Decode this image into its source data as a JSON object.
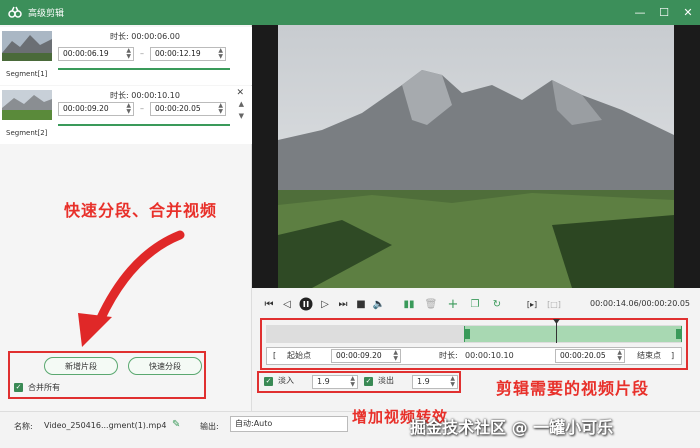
{
  "window": {
    "title": "高级剪辑",
    "minimize_icon": "minimize-icon",
    "maximize_icon": "maximize-icon",
    "close_icon": "close-icon"
  },
  "segments": [
    {
      "label": "Segment[1]",
      "duration_label": "时长:",
      "duration": "00:00:06.00",
      "start": "00:00:06.19",
      "end": "00:00:12.19",
      "separator": "–"
    },
    {
      "label": "Segment[2]",
      "duration_label": "时长:",
      "duration": "00:00:10.10",
      "start": "00:00:09.20",
      "end": "00:00:20.05",
      "separator": "–"
    }
  ],
  "left_panel": {
    "annotation": "快速分段、合并视频",
    "add_segment_button": "新增片段",
    "quick_split_button": "快速分段",
    "merge_all_label": "合并所有",
    "merge_all_checked": true
  },
  "player": {
    "timecode": "00:00:14.06/00:00:20.05",
    "range": {
      "start_label": "起始点",
      "start": "00:00:09.20",
      "duration_label": "时长:",
      "duration": "00:00:10.10",
      "end": "00:00:20.05",
      "end_label": "结束点",
      "bracket_open": "[",
      "bracket_close": "]"
    },
    "timeline_selection": {
      "start": 0.475,
      "end": 1.0,
      "playhead": 0.697
    },
    "fade_in_label": "淡入",
    "fade_in_value": "1.9",
    "fade_in_checked": true,
    "fade_out_label": "淡出",
    "fade_out_value": "1.9",
    "fade_out_checked": true,
    "annotation_segment": "剪辑需要的视频片段",
    "annotation_transition": "增加视频转效",
    "watermark": "掘金技术社区 @ 一罐小可乐"
  },
  "bottom": {
    "name_label": "名称:",
    "name_value": "Video_250416...gment(1).mp4",
    "output_label": "输出:",
    "output_value": "自动:Auto"
  },
  "colors": {
    "accent": "#3c8f5a",
    "annotation": "#e8302a"
  }
}
